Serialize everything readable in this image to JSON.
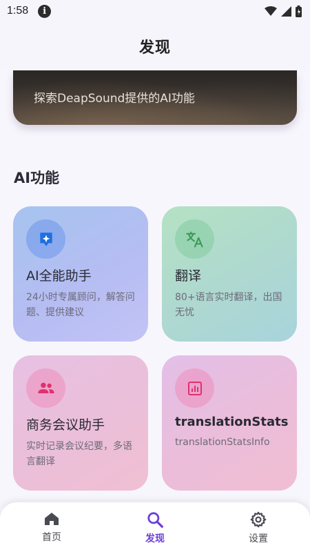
{
  "status_bar": {
    "time": "1:58",
    "info_icon": "info-icon",
    "wifi_icon": "wifi-icon",
    "signal_icon": "signal-icon",
    "battery_icon": "battery-icon"
  },
  "app_bar": {
    "title": "发现"
  },
  "banner": {
    "text": "探索DeapSound提供的AI功能"
  },
  "section": {
    "title": "AI功能"
  },
  "cards": [
    {
      "title": "AI全能助手",
      "description": "24小时专属顾问，解答问题、提供建议",
      "icon": "sparkle-chat-icon",
      "icon_color": "#1f6fe0"
    },
    {
      "title": "翻译",
      "description": "80+语言实时翻译，出国无忧",
      "icon": "translate-icon",
      "icon_color": "#3c9a58"
    },
    {
      "title": "商务会议助手",
      "description": "实时记录会议纪要，多语言翻译",
      "icon": "people-icon",
      "icon_color": "#e0306e"
    },
    {
      "title": "translationStats",
      "description": "translationStatsInfo",
      "icon": "stats-icon",
      "icon_color": "#e0306e"
    }
  ],
  "bottom_nav": {
    "items": [
      {
        "label": "首页",
        "icon": "home-icon",
        "active": false
      },
      {
        "label": "发现",
        "icon": "search-icon",
        "active": true
      },
      {
        "label": "设置",
        "icon": "gear-icon",
        "active": false
      }
    ],
    "active_color": "#6b3fd6"
  }
}
